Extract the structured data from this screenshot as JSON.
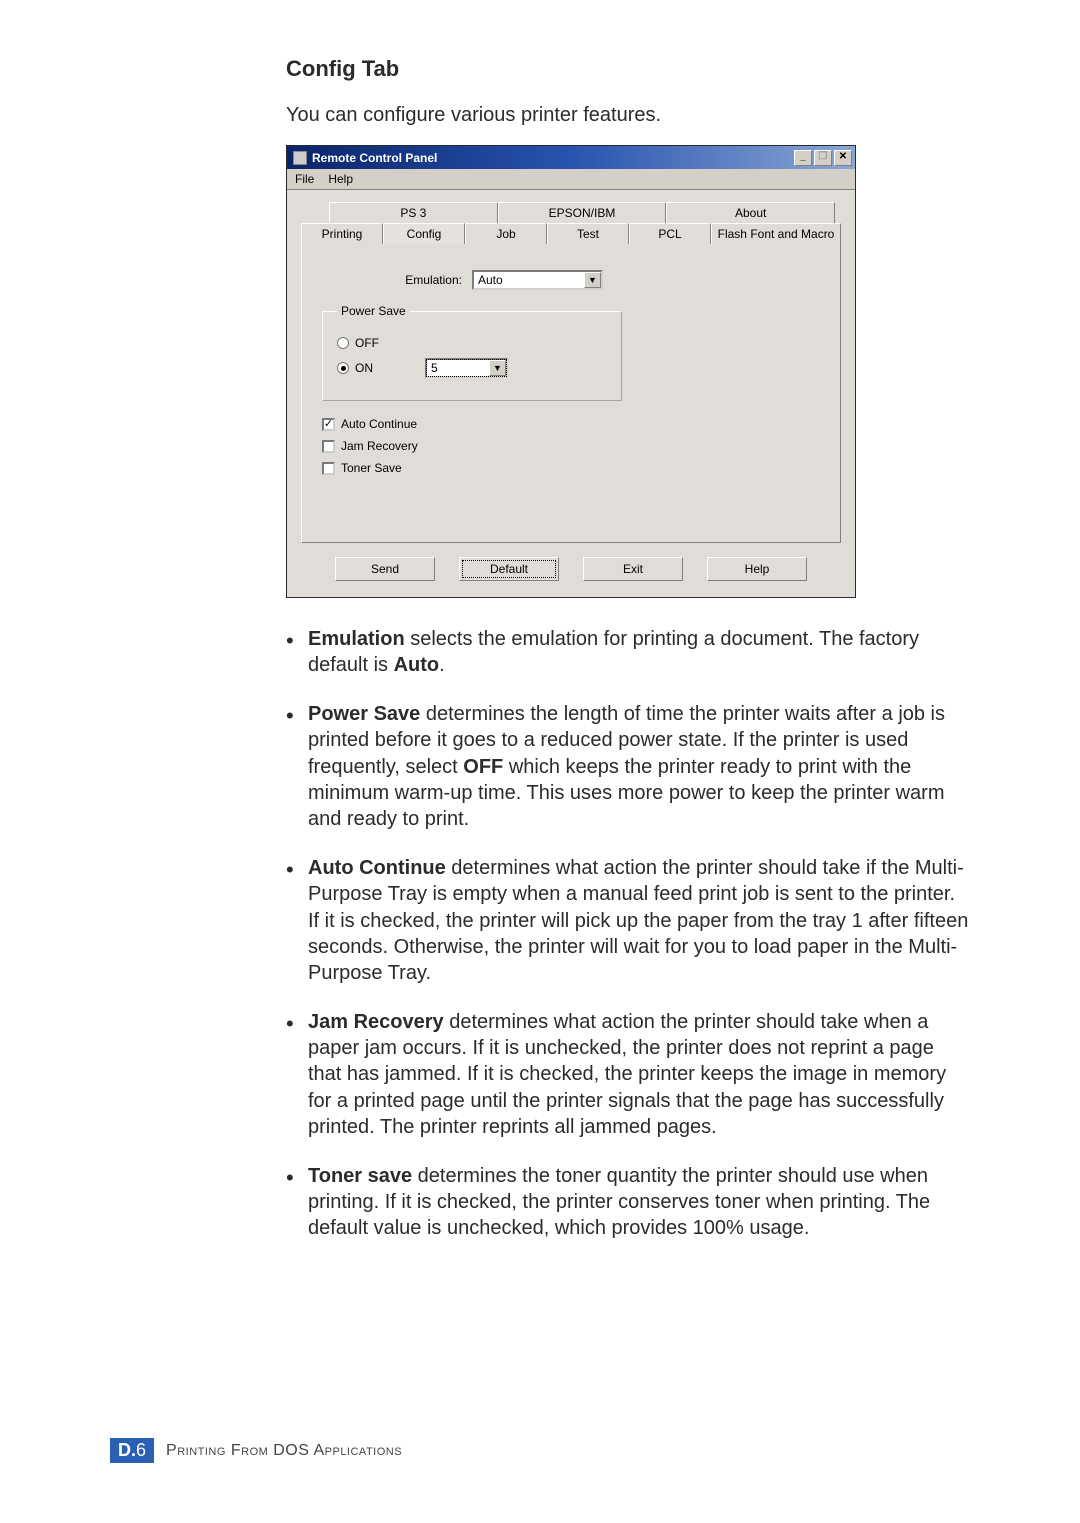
{
  "heading": "Config Tab",
  "intro": "You can configure various printer features.",
  "dialog": {
    "title": "Remote Control Panel",
    "menu": {
      "file": "File",
      "help": "Help"
    },
    "sysbtns": {
      "min": "_",
      "max": "❐",
      "close": "✕"
    },
    "tabs_row1": [
      "PS 3",
      "EPSON/IBM",
      "About"
    ],
    "tabs_row2": [
      "Printing",
      "Config",
      "Job",
      "Test",
      "PCL",
      "Flash Font and Macro"
    ],
    "emulation_label": "Emulation:",
    "emulation_value": "Auto",
    "powersave_legend": "Power Save",
    "powersave_off": "OFF",
    "powersave_on": "ON",
    "powersave_value": "5",
    "auto_continue": "Auto Continue",
    "jam_recovery": "Jam Recovery",
    "toner_save": "Toner Save",
    "buttons": {
      "send": "Send",
      "default": "Default",
      "exit": "Exit",
      "help": "Help"
    }
  },
  "bullets": {
    "emulation": {
      "term": "Emulation",
      "rest": " selects the emulation for printing a document. The factory default is ",
      "bold2": "Auto",
      "tail": "."
    },
    "powersave": {
      "term": "Power Save",
      "rest1": " determines the length of time the printer waits after a job is printed before it goes to a reduced power state. If the printer is used frequently, select ",
      "bold2": "OFF",
      "rest2": " which keeps the printer ready to print with the minimum warm-up time. This uses more power to keep the printer warm and ready to print."
    },
    "autocontinue": {
      "term": "Auto Continue",
      "rest": " determines what action the printer should take if the Multi-Purpose Tray is empty when a manual feed print job is sent to the printer. If it is checked, the printer will pick up the paper from the tray 1 after fifteen seconds. Otherwise, the printer will wait for you to load paper in the Multi-Purpose Tray."
    },
    "jamrecovery": {
      "term": "Jam Recovery",
      "rest": " determines what action the printer should take when a paper jam occurs. If it is unchecked, the printer does not reprint a page that has jammed. If it is checked, the printer keeps the image in memory for a printed page until the printer signals that the page has successfully printed. The printer reprints all jammed pages."
    },
    "tonersave": {
      "term": "Toner save",
      "rest": " determines the toner quantity the printer should use when printing. If it is checked, the printer conserves toner when printing. The default value is unchecked, which provides 100% usage."
    }
  },
  "footer": {
    "section": "D.",
    "page": "6",
    "caption": "Printing From DOS Applications"
  }
}
